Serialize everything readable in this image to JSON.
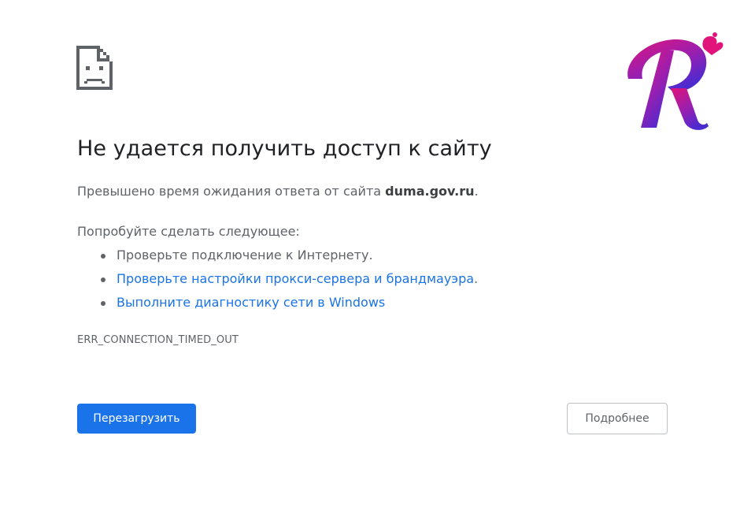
{
  "error_page": {
    "icon": "sad-document-icon",
    "title": "Не удается получить доступ к сайту",
    "summary_prefix": "Превышено время ожидания ответа от сайта ",
    "host": "duma.gov.ru",
    "summary_suffix": ".",
    "suggestions_heading": "Попробуйте сделать следующее:",
    "suggestions": [
      {
        "text": "Проверьте подключение к Интернету.",
        "link": false
      },
      {
        "text": "Проверьте настройки прокси-сервера и брандмауэра",
        "link": true,
        "after": "."
      },
      {
        "text": "Выполните диагностику сети в Windows",
        "link": true,
        "after": ""
      }
    ],
    "error_code": "ERR_CONNECTION_TIMED_OUT",
    "reload_button": "Перезагрузить",
    "details_button": "Подробнее"
  },
  "logo": {
    "letter": "R",
    "icon": "brand-r-logo"
  },
  "colors": {
    "accent": "#1a73e8",
    "text": "#202124",
    "secondary_text": "#5f6368",
    "logo_gradient_start": "#e0147a",
    "logo_gradient_end": "#4a2bd0"
  }
}
